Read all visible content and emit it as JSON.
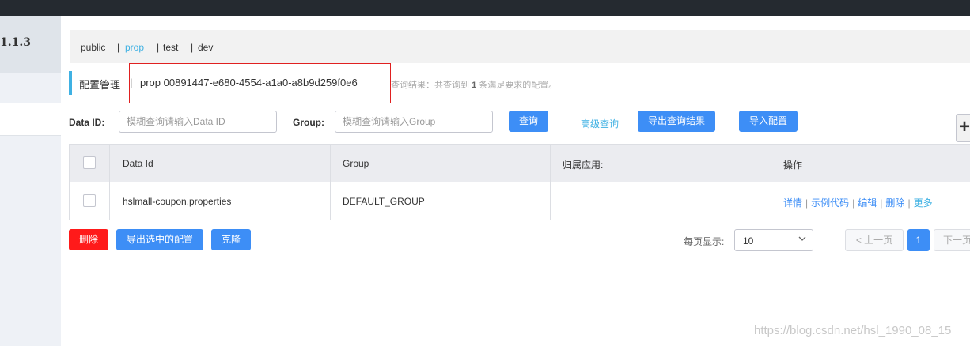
{
  "version": "1.1.3",
  "namespaces": [
    {
      "label": "public",
      "active": false
    },
    {
      "label": "prop",
      "active": true
    },
    {
      "label": "test",
      "active": false
    },
    {
      "label": "dev",
      "active": false
    }
  ],
  "header": {
    "title": "配置管理",
    "pipe": "|",
    "namespace_info": "prop  00891447-e680-4554-a1a0-a8b9d259f0e6",
    "result_prefix": "查询结果：共查询到",
    "result_count": "1",
    "result_suffix": "条满足要求的配置。"
  },
  "filters": {
    "data_id_label": "Data ID:",
    "data_id_placeholder": "模糊查询请输入Data ID",
    "group_label": "Group:",
    "group_placeholder": "模糊查询请输入Group",
    "query_button": "查询",
    "advanced_query": "高级查询",
    "export_results_button": "导出查询结果",
    "import_config_button": "导入配置",
    "add_icon": "plus-icon"
  },
  "table": {
    "columns": [
      "Data Id",
      "Group",
      "归属应用:",
      "操作"
    ],
    "rows": [
      {
        "data_id": "hslmall-coupon.properties",
        "group": "DEFAULT_GROUP",
        "app": "",
        "actions": [
          "详情",
          "示例代码",
          "编辑",
          "删除",
          "更多"
        ]
      }
    ]
  },
  "footer": {
    "delete_button": "删除",
    "export_selected_button": "导出选中的配置",
    "clone_button": "克隆",
    "page_size_label": "每页显示:",
    "page_size": "10",
    "prev_page": "上一页",
    "current_page": "1",
    "next_page": "下一页"
  },
  "watermark": "https://blog.csdn.net/hsl_1990_08_15",
  "colors": {
    "accent": "#3d8ef6",
    "link": "#3fb1e3",
    "danger": "#ff1a1a",
    "highlight_border": "#e02020"
  }
}
